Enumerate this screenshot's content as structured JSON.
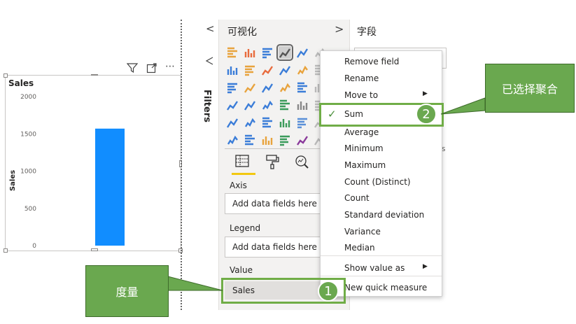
{
  "visual": {
    "header_icons": [
      "filter-icon",
      "focus-mode-icon",
      "more-options-icon"
    ],
    "more_options_glyph": "⋯"
  },
  "chart_data": {
    "type": "bar",
    "title": "Sales",
    "ylabel": "Sales",
    "xlabel": "",
    "categories": [
      ""
    ],
    "series": [
      {
        "values": [
          1570
        ],
        "color": "#118dff"
      }
    ],
    "ylim": [
      0,
      2000
    ],
    "yticks": [
      0,
      500,
      1000,
      1500,
      2000
    ],
    "grid": false,
    "legend": "none"
  },
  "filters": {
    "label": "Filters",
    "collapse_glyph": "<"
  },
  "visualizations": {
    "title": "可视化",
    "collapse_glyph": ">",
    "tabs": [
      "fields-tab-icon",
      "format-tab-icon",
      "analytics-tab-icon"
    ],
    "wells": [
      {
        "label": "Axis",
        "value": "Add data fields here"
      },
      {
        "label": "Legend",
        "value": "Add data fields here"
      },
      {
        "label": "Value",
        "value": "Sales"
      }
    ]
  },
  "fields": {
    "title": "字段",
    "peek_text": "es"
  },
  "context_menu": {
    "items": [
      {
        "label": "Remove field"
      },
      {
        "label": "Rename"
      },
      {
        "label": "Move to",
        "submenu": true
      },
      {
        "label": "Sum",
        "checked": true
      },
      {
        "label": "Average"
      },
      {
        "label": "Minimum"
      },
      {
        "label": "Maximum"
      },
      {
        "label": "Count (Distinct)"
      },
      {
        "label": "Count"
      },
      {
        "label": "Standard deviation"
      },
      {
        "label": "Variance"
      },
      {
        "label": "Median"
      },
      {
        "label": "Show value as",
        "submenu": true
      },
      {
        "label": "New quick measure"
      }
    ],
    "check_glyph": "✓",
    "submenu_glyph": "▶"
  },
  "annotations": {
    "callout_measure": "度量",
    "callout_aggregate": "已选择聚合",
    "badge_1": "1",
    "badge_2": "2",
    "accent": "#70ad47"
  }
}
